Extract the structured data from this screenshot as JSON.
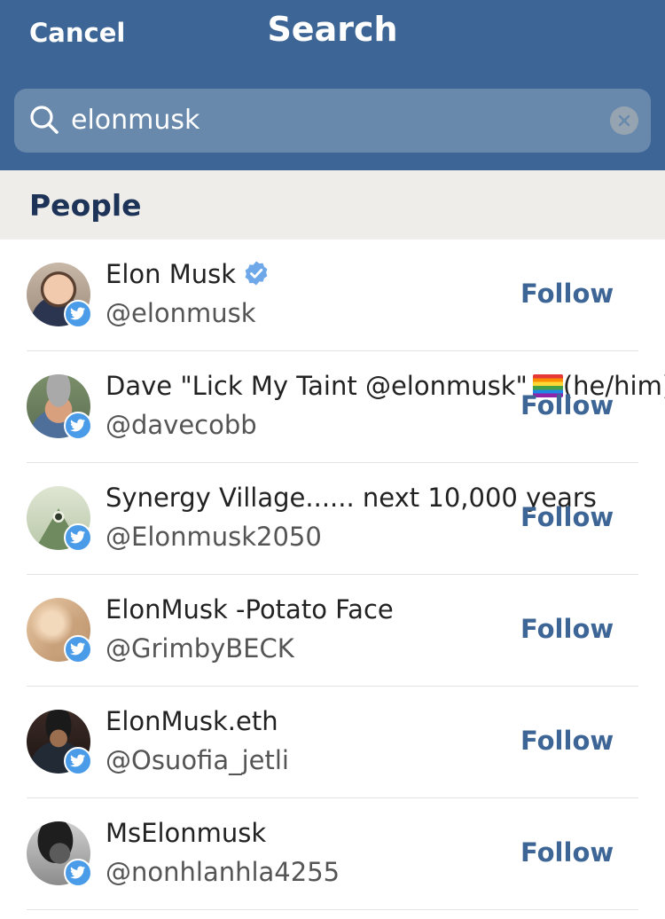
{
  "header": {
    "cancel_label": "Cancel",
    "title": "Search",
    "background": "#3d6696"
  },
  "search": {
    "value": "elonmusk",
    "icon": "search-icon",
    "clear_icon": "clear-icon"
  },
  "section": {
    "title": "People"
  },
  "people": [
    {
      "name": "Elon Musk",
      "handle": "@elonmusk",
      "verified": true,
      "follow_label": "Follow",
      "avatar": "avatar-photo"
    },
    {
      "name": "Dave \"Lick My Taint @elonmusk\"",
      "name_suffix": "(he/him)",
      "flag": "rainbow-flag",
      "handle": "@davecobb",
      "follow_label": "Follow",
      "avatar": "avatar-photo"
    },
    {
      "name": "Synergy Village...... next 10,000 years",
      "handle": "@Elonmusk2050",
      "follow_label": "Follow",
      "avatar": "avatar-photo"
    },
    {
      "name": "ElonMusk -Potato Face",
      "handle": "@GrimbyBECK",
      "follow_label": "Follow",
      "avatar": "avatar-photo"
    },
    {
      "name": "ElonMusk.eth",
      "handle": "@Osuofia_jetli",
      "follow_label": "Follow",
      "avatar": "avatar-photo"
    },
    {
      "name": "MsElonmusk",
      "handle": "@nonhlanhla4255",
      "follow_label": "Follow",
      "avatar": "avatar-photo"
    }
  ],
  "colors": {
    "accent": "#3d6696",
    "twitter_badge": "#4a9be8",
    "verified": "#4a9be8"
  }
}
